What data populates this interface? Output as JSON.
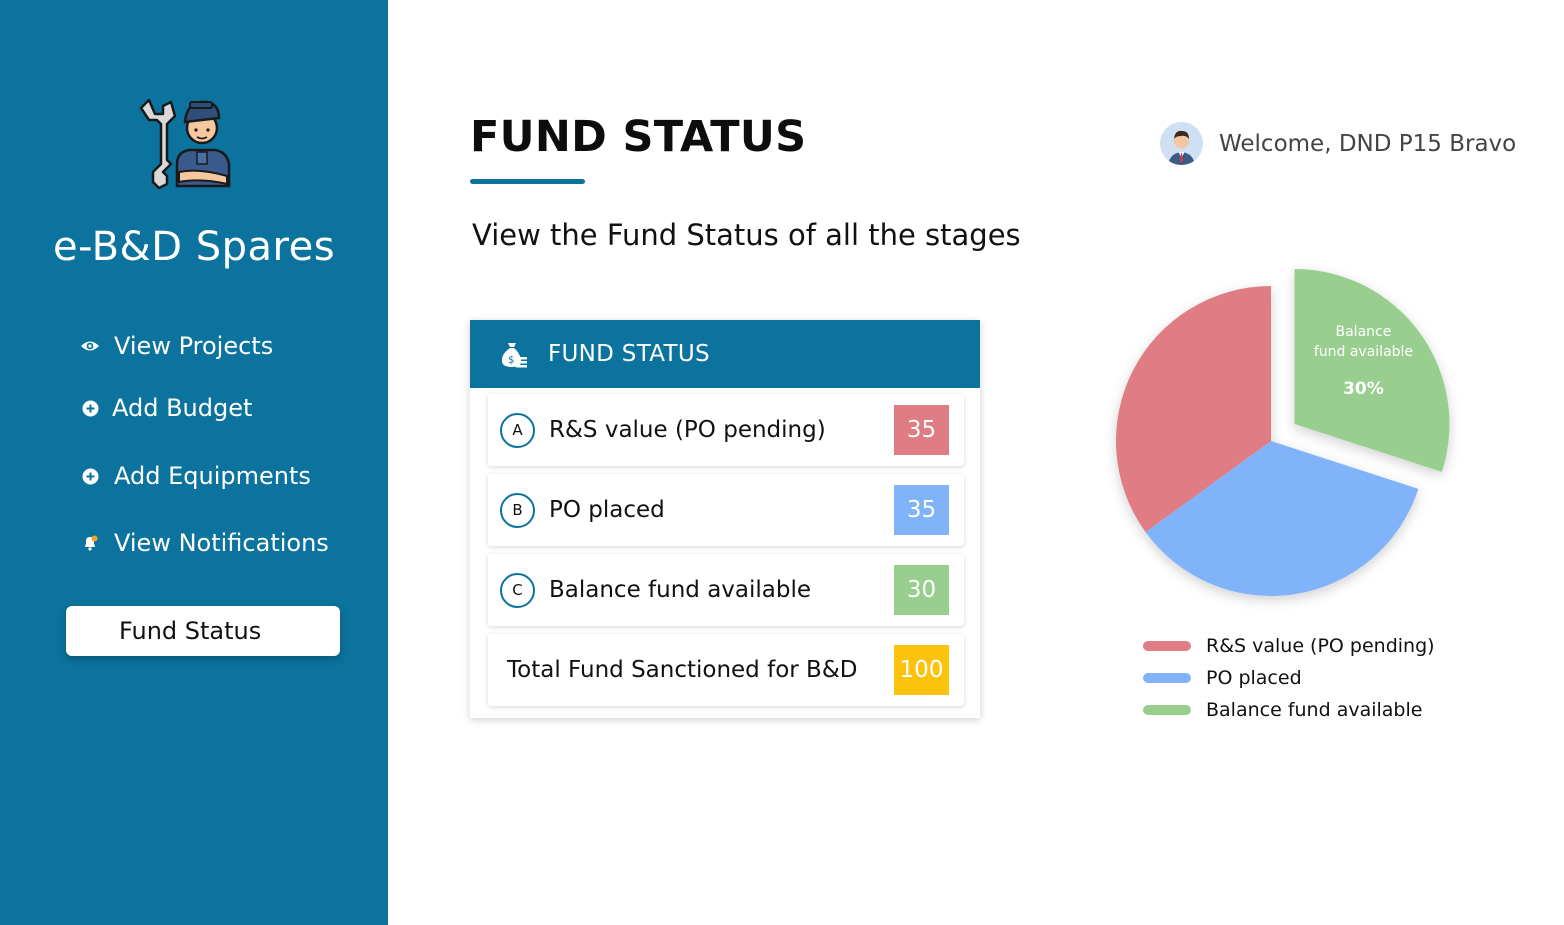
{
  "sidebar": {
    "brand": "e-B&D Spares",
    "items": [
      {
        "label": "View Projects",
        "icon": "eye-icon"
      },
      {
        "label": "Add Budget",
        "icon": "plus-circle-icon"
      },
      {
        "label": "Add Equipments",
        "icon": "plus-circle-icon"
      },
      {
        "label": "View Notifications",
        "icon": "bell-icon"
      }
    ],
    "active_item": "Fund Status"
  },
  "header": {
    "title": "FUND STATUS",
    "subtitle": "View the Fund Status of all the stages",
    "welcome": "Welcome, DND P15 Bravo"
  },
  "card": {
    "title": "FUND STATUS",
    "rows": [
      {
        "letter": "A",
        "label": "R&S value (PO pending)",
        "value": "35",
        "color": "#e07d84"
      },
      {
        "letter": "B",
        "label": "PO placed",
        "value": "35",
        "color": "#80b3f9"
      },
      {
        "letter": "C",
        "label": "Balance fund available",
        "value": "30",
        "color": "#98cf8f"
      }
    ],
    "total": {
      "label": "Total Fund Sanctioned for B&D",
      "value": "100",
      "color": "#fdc30c"
    }
  },
  "chart_data": {
    "type": "pie",
    "categories": [
      "R&S value (PO pending)",
      "PO placed",
      "Balance fund available"
    ],
    "values": [
      35,
      35,
      30
    ],
    "colors": [
      "#e07d84",
      "#80b3f9",
      "#98cf8f"
    ],
    "exploded": [
      "Balance fund available"
    ],
    "slice_labels": [
      {
        "category": "Balance fund available",
        "line1": "Balance",
        "line2": "fund available",
        "value": "30%"
      }
    ],
    "legend_position": "bottom"
  },
  "legend": [
    {
      "label": "R&S value (PO pending)",
      "color": "#e07d84"
    },
    {
      "label": "PO placed",
      "color": "#80b3f9"
    },
    {
      "label": "Balance fund available",
      "color": "#98cf8f"
    }
  ]
}
